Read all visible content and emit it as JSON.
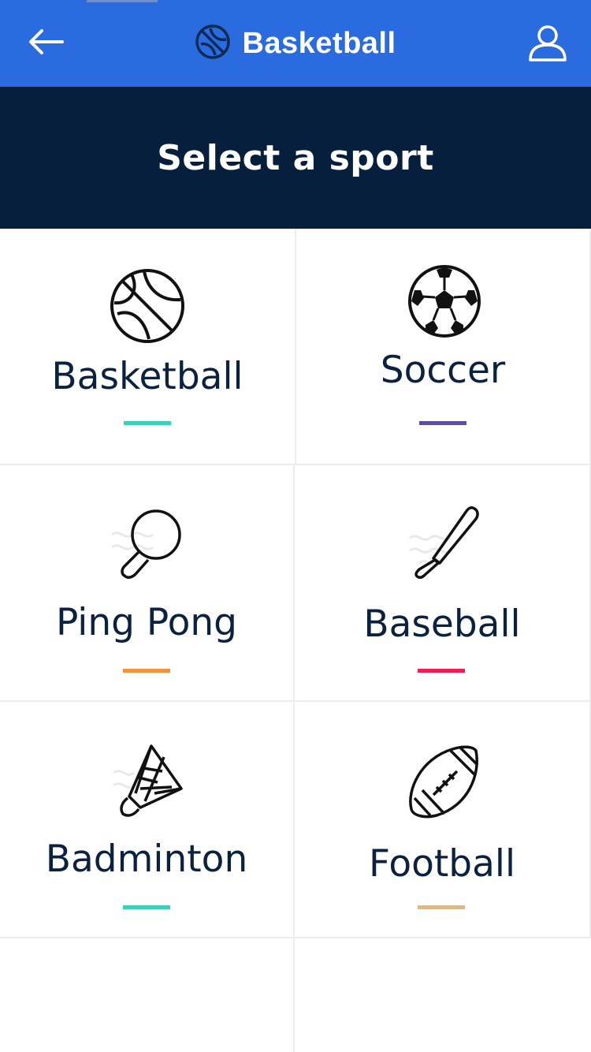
{
  "header": {
    "title": "Basketball",
    "background": "#2a6be0",
    "back_icon": "arrow-left-icon",
    "title_icon": "basketball-icon",
    "profile_icon": "user-icon"
  },
  "banner": {
    "heading": "Select a sport",
    "background": "#061f3c"
  },
  "sports": [
    {
      "label": "Basketball",
      "icon": "basketball-icon",
      "accent": "#3fcfb8"
    },
    {
      "label": "Soccer",
      "icon": "soccer-ball-icon",
      "accent": "#5b4e9c"
    },
    {
      "label": "Ping Pong",
      "icon": "ping-pong-paddle-icon",
      "accent": "#f0933a"
    },
    {
      "label": "Baseball",
      "icon": "baseball-bat-icon",
      "accent": "#ee1f57"
    },
    {
      "label": "Badminton",
      "icon": "shuttlecock-icon",
      "accent": "#3fcfb8"
    },
    {
      "label": "Football",
      "icon": "american-football-icon",
      "accent": "#d9b98a"
    }
  ]
}
